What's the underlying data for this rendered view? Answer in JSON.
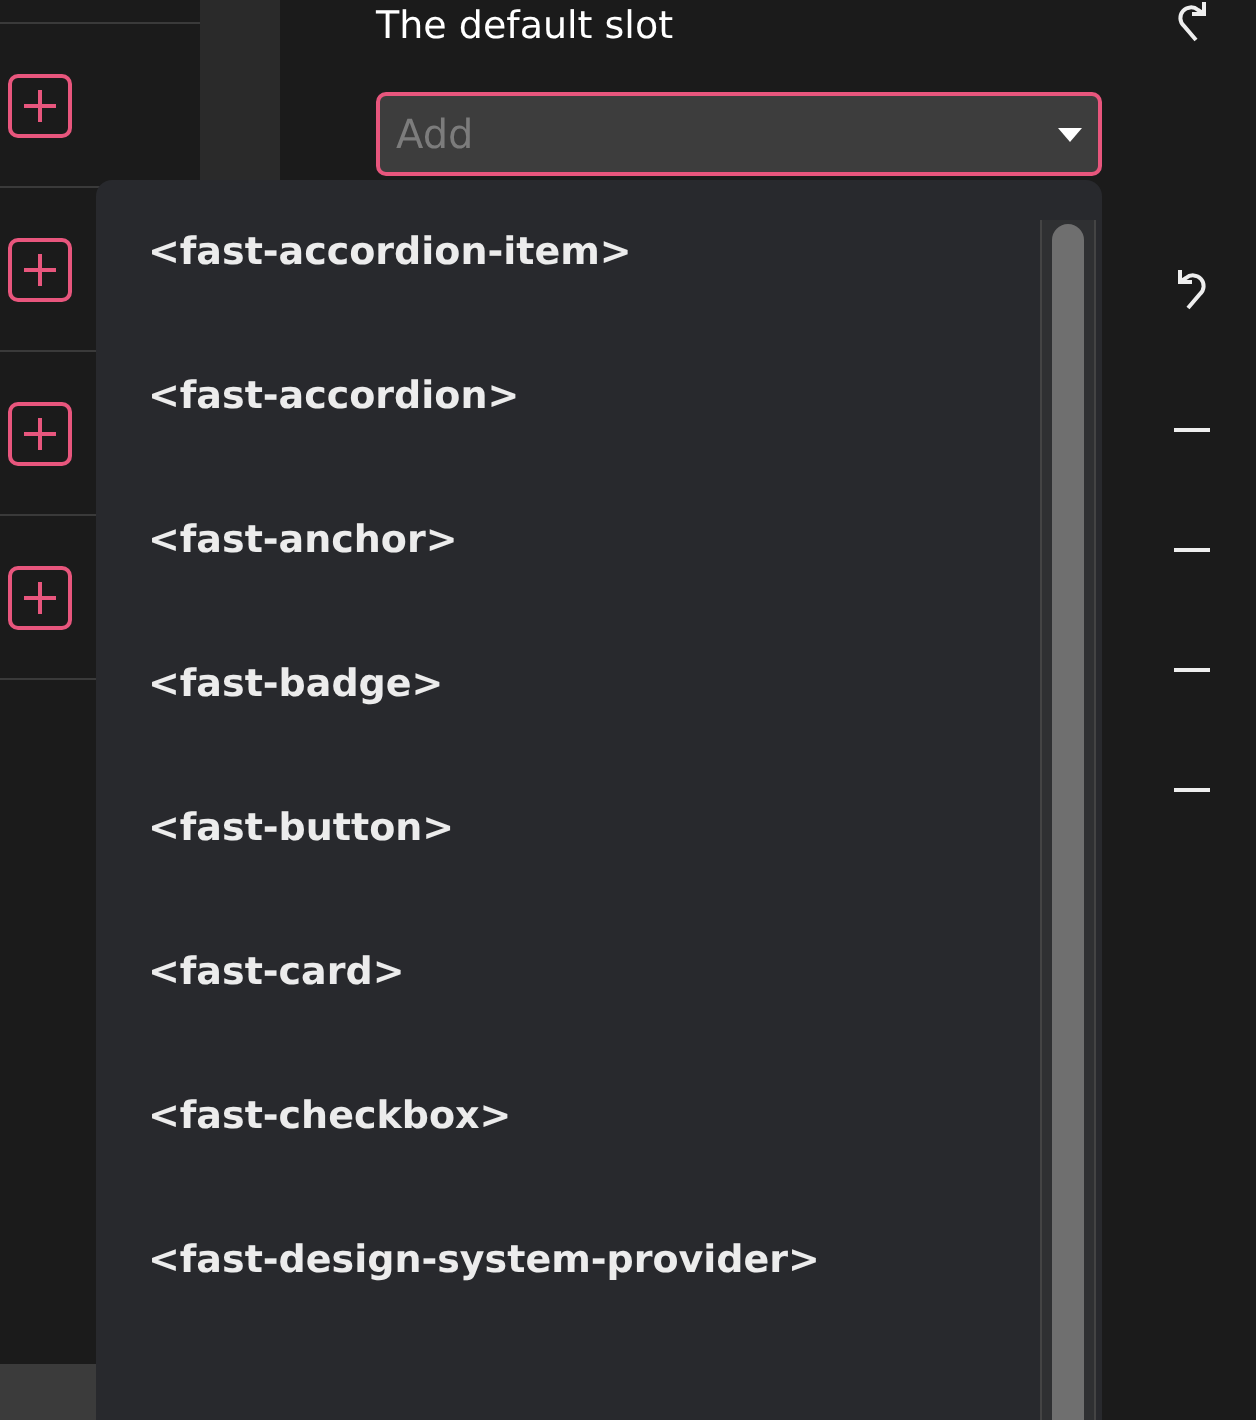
{
  "slot": {
    "label": "The default slot",
    "select": {
      "placeholder": "Add",
      "expanded": true
    }
  },
  "options": [
    "<fast-accordion-item>",
    "<fast-accordion>",
    "<fast-anchor>",
    "<fast-badge>",
    "<fast-button>",
    "<fast-card>",
    "<fast-checkbox>",
    "<fast-design-system-provider>"
  ]
}
